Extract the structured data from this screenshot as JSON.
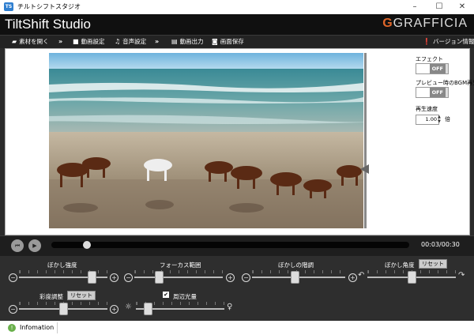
{
  "window": {
    "caption": "チルトシフトスタジオ",
    "icon_text": "TS",
    "minimize": "–",
    "maximize": "☐",
    "close": "✕"
  },
  "header": {
    "app_title": "TiltShift Studio",
    "brand_mark": "G",
    "brand_text": "GRAFFICIA"
  },
  "toolbar": {
    "open": "素材を開く",
    "video_settings": "動画設定",
    "audio_settings": "音声設定",
    "video_output": "動画出力",
    "save_image": "画面保存",
    "arrow": "»",
    "version_info": "バージョン情報"
  },
  "side_panel": {
    "effect_label": "エフェクト",
    "effect_state": "OFF",
    "bgm_label": "プレビュー時のBGM再生",
    "bgm_state": "OFF",
    "speed_label": "再生速度",
    "speed_value": "1.00",
    "speed_unit": "倍"
  },
  "transport": {
    "current_time": "00:03",
    "duration": "00:30",
    "time_display": "00:03/00:30",
    "progress": 0.1
  },
  "controls": {
    "blur_strength": {
      "label": "ぼかし強度",
      "value": 0.85
    },
    "focus_range": {
      "label": "フォーカス範囲",
      "value": 0.25
    },
    "blur_falloff": {
      "label": "ぼかしの階調",
      "value": 0.45
    },
    "blur_angle": {
      "label": "ぼかし角度",
      "reset": "リセット",
      "value": 0.5
    },
    "saturation": {
      "label": "彩度調整",
      "reset": "リセット",
      "value": 0.5
    },
    "vignette": {
      "label": "周辺光量",
      "checked": true,
      "value": 0.1
    }
  },
  "status_bar": {
    "label": "Infomation"
  },
  "colors": {
    "accent": "#e0672a",
    "info_green": "#6ab04c"
  }
}
